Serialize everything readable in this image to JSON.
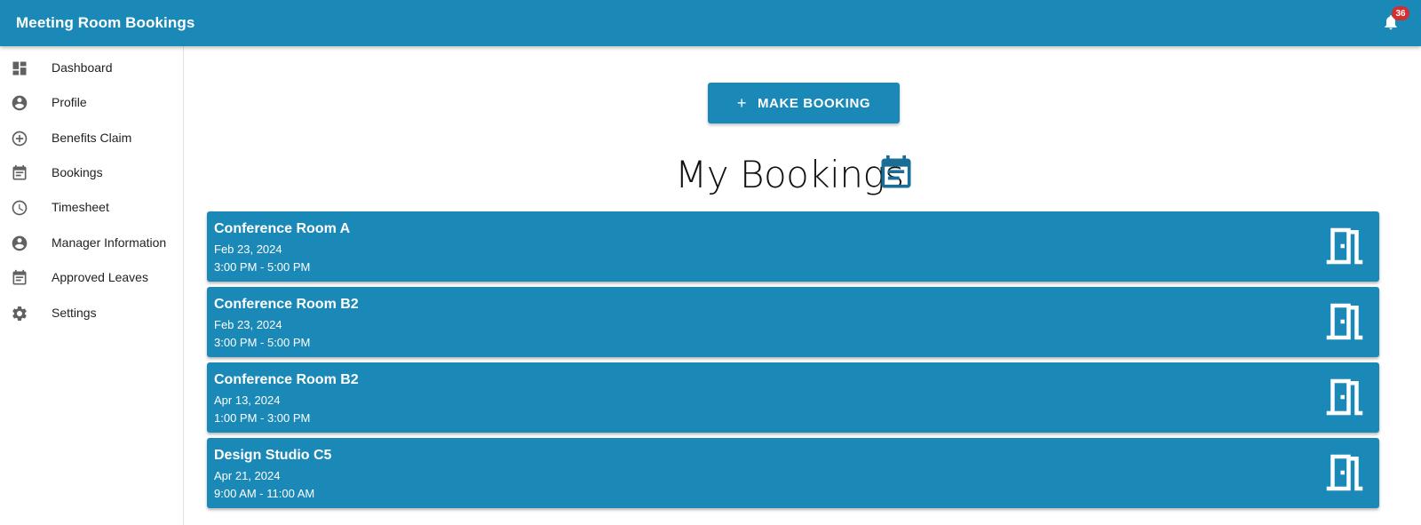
{
  "app": {
    "title": "Meeting Room Bookings"
  },
  "notifications": {
    "count": "36",
    "icon": "bell-icon"
  },
  "sidebar": {
    "items": [
      {
        "label": "Dashboard",
        "icon": "dashboard-icon"
      },
      {
        "label": "Profile",
        "icon": "account-circle-icon"
      },
      {
        "label": "Benefits Claim",
        "icon": "add-circle-icon"
      },
      {
        "label": "Bookings",
        "icon": "calendar-event-icon"
      },
      {
        "label": "Timesheet",
        "icon": "clock-icon"
      },
      {
        "label": "Manager Information",
        "icon": "account-circle-icon"
      },
      {
        "label": "Approved Leaves",
        "icon": "calendar-event-icon"
      },
      {
        "label": "Settings",
        "icon": "gear-icon"
      }
    ]
  },
  "main": {
    "make_booking": {
      "plus": "+",
      "label": "MAKE BOOKING"
    },
    "heading": "My Bookings",
    "bookings": [
      {
        "room": "Conference Room A",
        "date": "Feb 23, 2024",
        "time": "3:00 PM - 5:00 PM"
      },
      {
        "room": "Conference Room B2",
        "date": "Feb 23, 2024",
        "time": "3:00 PM - 5:00 PM"
      },
      {
        "room": "Conference Room B2",
        "date": "Apr 13, 2024",
        "time": "1:00 PM - 3:00 PM"
      },
      {
        "room": "Design Studio C5",
        "date": "Apr 21, 2024",
        "time": "9:00 AM - 11:00 AM"
      }
    ]
  },
  "colors": {
    "primary": "#1a89b8",
    "badge": "#d32f2f",
    "sidebar_icon": "#616161",
    "heading_icon": "#1a6e96"
  }
}
